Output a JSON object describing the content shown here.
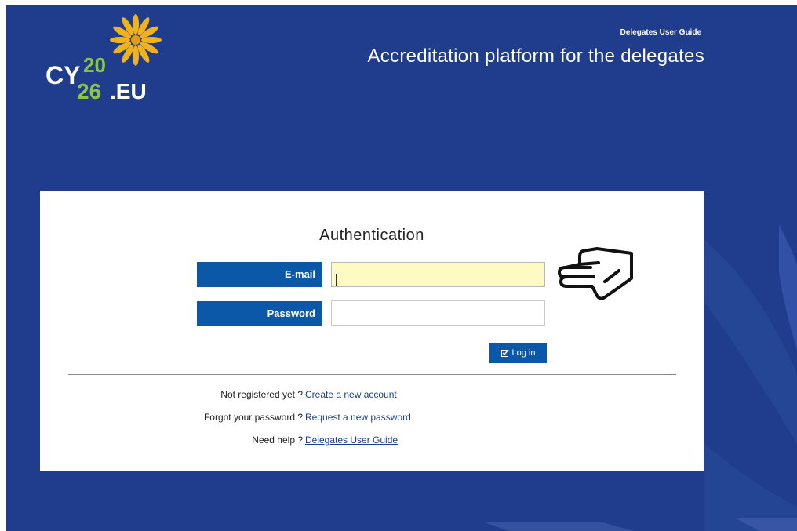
{
  "header": {
    "logo": {
      "part_cy": "CY",
      "part_20": "20",
      "part_26": "26",
      "part_eu": ".EU"
    },
    "guide_link": "Delegates User Guide",
    "title": "Accreditation platform for the delegates"
  },
  "auth": {
    "title": "Authentication",
    "email_label": "E-mail",
    "email_value": "",
    "password_label": "Password",
    "password_value": "",
    "login_label": "Log in",
    "login_icon": "check-square-icon"
  },
  "help": [
    {
      "label": "Not registered yet ?",
      "link": "Create a new account"
    },
    {
      "label": "Forgot your password ?",
      "link": "Request a new password"
    },
    {
      "label": "Need help ?",
      "link": "Delegates User Guide"
    }
  ],
  "colors": {
    "background": "#1f3d8c",
    "accent": "#0b58a8",
    "logo_green": "#8cc63f",
    "logo_gold": "#f2b21c",
    "email_highlight": "#fdfbc2"
  }
}
